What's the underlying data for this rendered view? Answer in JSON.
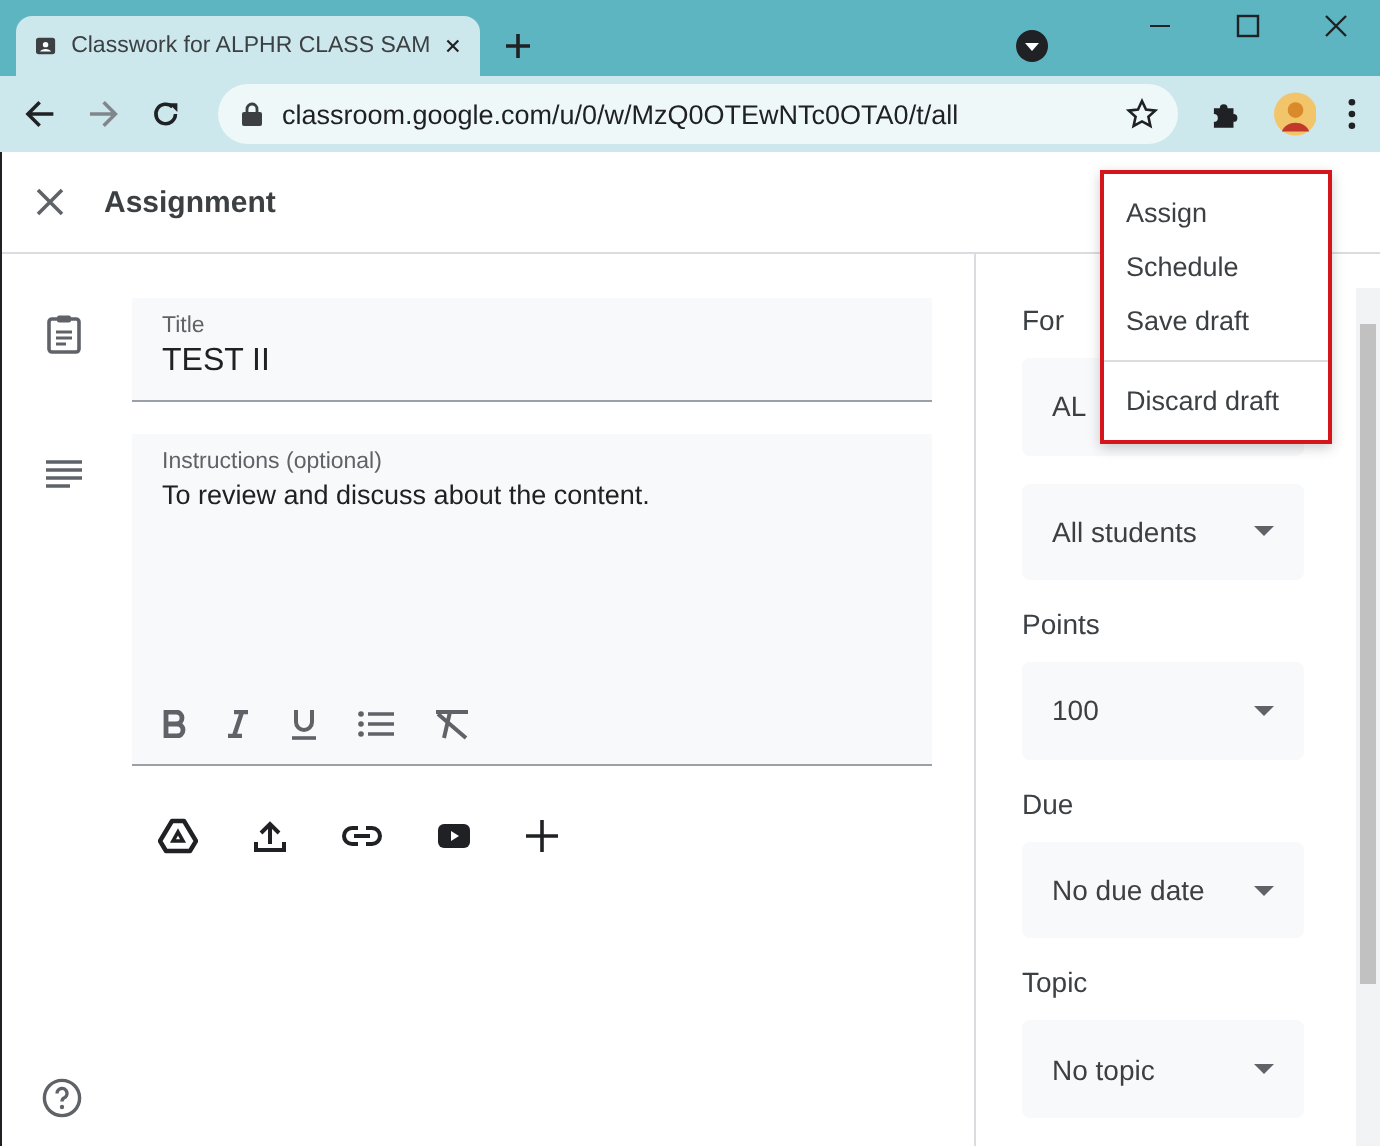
{
  "browser": {
    "tab_title": "Classwork for ALPHR CLASS SAM",
    "url": "classroom.google.com/u/0/w/MzQ0OTEwNTc0OTA0/t/all"
  },
  "header": {
    "title": "Assignment"
  },
  "title_field": {
    "label": "Title",
    "value": "TEST II"
  },
  "instructions_field": {
    "label": "Instructions (optional)",
    "value": "To review and discuss about the content."
  },
  "sections": [
    {
      "label": "For",
      "dropdowns": [
        {
          "value": "AL",
          "caret": false
        },
        {
          "value": "All students",
          "caret": true
        }
      ]
    },
    {
      "label": "Points",
      "dropdowns": [
        {
          "value": "100",
          "caret": true
        }
      ]
    },
    {
      "label": "Due",
      "dropdowns": [
        {
          "value": "No due date",
          "caret": true
        }
      ]
    },
    {
      "label": "Topic",
      "dropdowns": [
        {
          "value": "No topic",
          "caret": true
        }
      ]
    }
  ],
  "menu": {
    "items": [
      {
        "label": "Assign",
        "divider_before": false
      },
      {
        "label": "Schedule",
        "divider_before": false
      },
      {
        "label": "Save draft",
        "divider_before": false
      },
      {
        "label": "Discard draft",
        "divider_before": true
      }
    ]
  }
}
